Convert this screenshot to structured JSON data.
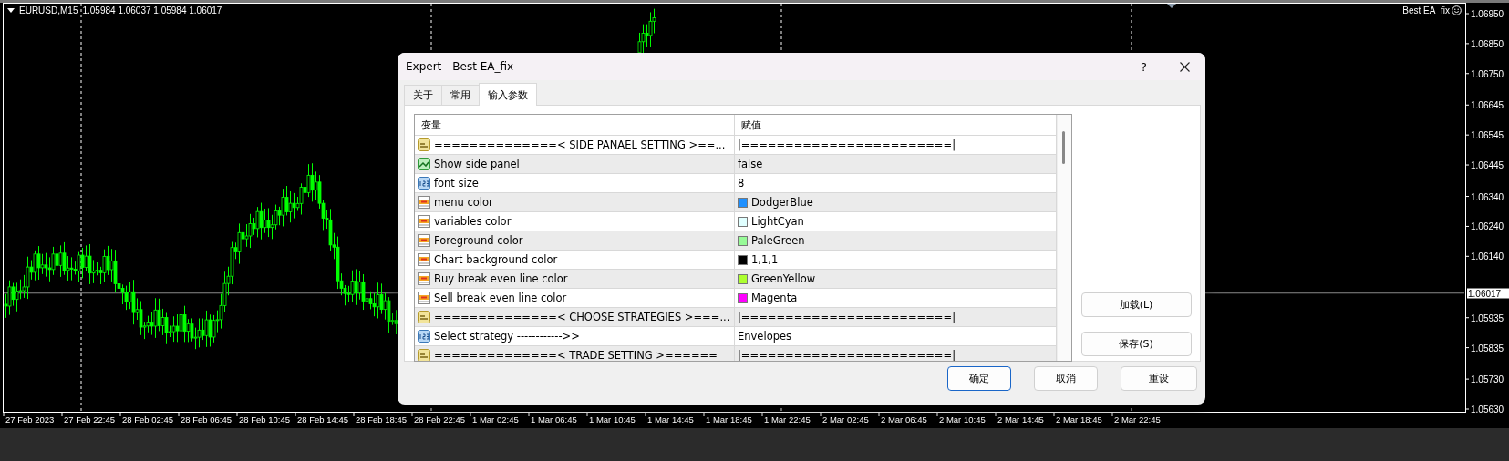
{
  "chart": {
    "symbol": "EURUSD,M15",
    "quotes": "1.05984 1.06037 1.05984 1.06017",
    "expert_name": "Best EA_fix",
    "price_labels": [
      "1.06950",
      "1.06850",
      "1.06750",
      "1.06645",
      "1.06545",
      "1.06445",
      "1.06340",
      "1.06240",
      "1.06140",
      "1.05935",
      "1.05835",
      "1.05730",
      "1.05630"
    ],
    "current_price": "1.06017",
    "time_labels": [
      "27 Feb 2023",
      "27 Feb 22:45",
      "28 Feb 02:45",
      "28 Feb 06:45",
      "28 Feb 10:45",
      "28 Feb 14:45",
      "28 Feb 18:45",
      "28 Feb 22:45",
      "1 Mar 02:45",
      "1 Mar 06:45",
      "1 Mar 10:45",
      "1 Mar 14:45",
      "1 Mar 18:45",
      "1 Mar 22:45",
      "2 Mar 02:45",
      "2 Mar 06:45",
      "2 Mar 10:45",
      "2 Mar 14:45",
      "2 Mar 18:45",
      "2 Mar 22:45"
    ]
  },
  "dialog": {
    "title": "Expert - Best EA_fix",
    "help": "?",
    "tabs": [
      {
        "label": "关于",
        "selected": false
      },
      {
        "label": "常用",
        "selected": false
      },
      {
        "label": "输入参数",
        "selected": true
      }
    ],
    "columns": [
      "变量",
      "赋值"
    ],
    "rows": [
      {
        "kind": "string",
        "name": "==============< SIDE PANAEL SETTING >==...",
        "value": "|========================|"
      },
      {
        "kind": "bool",
        "name": "Show side panel",
        "value": "false"
      },
      {
        "kind": "int",
        "name": "font size",
        "value": "8"
      },
      {
        "kind": "color",
        "name": "menu color",
        "value": "DodgerBlue",
        "color": "#1e90ff"
      },
      {
        "kind": "color",
        "name": "variables color",
        "value": "LightCyan",
        "color": "#e0ffff"
      },
      {
        "kind": "color",
        "name": "Foreground color",
        "value": "PaleGreen",
        "color": "#98fb98"
      },
      {
        "kind": "color",
        "name": "Chart background color",
        "value": "1,1,1",
        "color": "#010101"
      },
      {
        "kind": "color",
        "name": "Buy break even line color",
        "value": "GreenYellow",
        "color": "#adff2f"
      },
      {
        "kind": "color",
        "name": "Sell break even line color",
        "value": "Magenta",
        "color": "#ff00ff"
      },
      {
        "kind": "string",
        "name": "==============< CHOOSE STRATEGIES >===...",
        "value": "|========================|"
      },
      {
        "kind": "int",
        "name": "Select strategy ------------>>",
        "value": "Envelopes"
      },
      {
        "kind": "string",
        "name": "==============< TRADE SETTING >======",
        "value": "|========================|"
      }
    ],
    "side_buttons": [
      "加载(L)",
      "保存(S)"
    ],
    "buttons": [
      {
        "label": "确定",
        "default": true
      },
      {
        "label": "取消",
        "default": false
      },
      {
        "label": "重设",
        "default": false
      }
    ]
  }
}
